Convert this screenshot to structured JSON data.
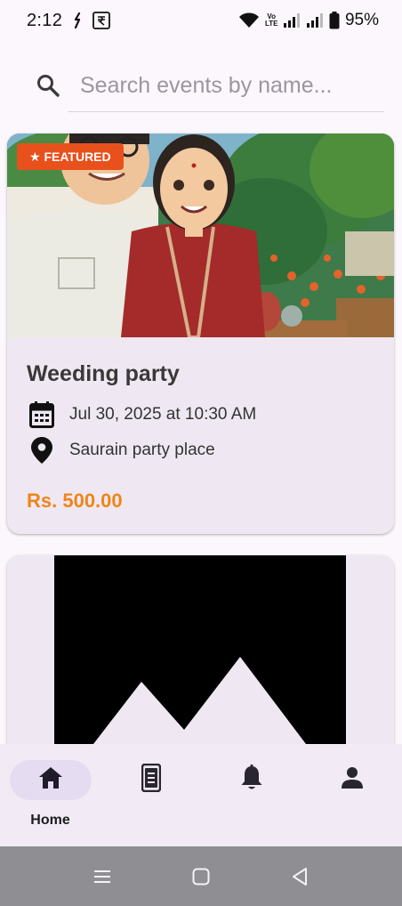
{
  "status_bar": {
    "time": "2:12",
    "volte_label": "Vo LTE",
    "battery_percent": "95%",
    "icons": [
      "notification-icon",
      "rupee-app-icon",
      "wifi-icon",
      "volte-icon",
      "signal-icon",
      "signal-icon",
      "battery-icon"
    ]
  },
  "search": {
    "placeholder": "Search events by name...",
    "value": "",
    "icon": "search-icon"
  },
  "events": [
    {
      "featured_label": "★ FEATURED",
      "title": "Weeding party",
      "date": "Jul 30, 2025 at 10:30 AM",
      "location": "Saurain party place",
      "price": "Rs. 500.00",
      "image": "illustration-couple"
    },
    {
      "image": "image-placeholder"
    }
  ],
  "bottom_nav": {
    "items": [
      {
        "label": "Home",
        "icon": "home-icon",
        "active": true
      },
      {
        "label": "",
        "icon": "tickets-icon",
        "active": false
      },
      {
        "label": "",
        "icon": "bell-icon",
        "active": false
      },
      {
        "label": "",
        "icon": "profile-icon",
        "active": false
      }
    ]
  },
  "colors": {
    "background": "#fcf7fd",
    "card": "#efe8f2",
    "featured_badge": "#e8511c",
    "price": "#ef8518",
    "nav_active_pill": "#e5dcf1",
    "system_nav": "#8f8e93"
  }
}
